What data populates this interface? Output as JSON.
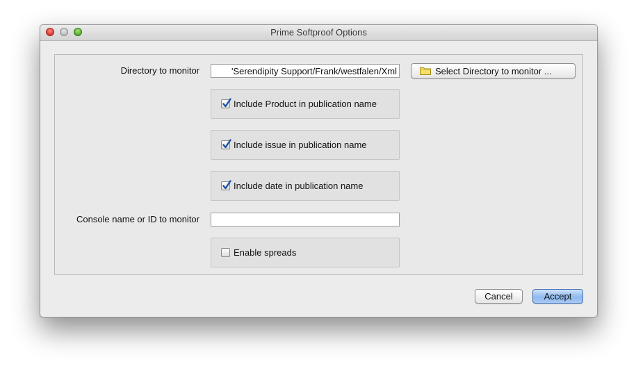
{
  "window": {
    "title": "Prime Softproof Options"
  },
  "directory": {
    "label": "Directory to monitor",
    "value": "'Serendipity Support/Frank/westfalen/Xml",
    "select_button": "Select Directory to monitor ..."
  },
  "options": [
    {
      "label": "Include Product in publication name",
      "checked": true
    },
    {
      "label": "Include issue in publication name",
      "checked": true
    },
    {
      "label": "Include date in publication name",
      "checked": true
    }
  ],
  "console": {
    "label": "Console name or ID to monitor",
    "value": ""
  },
  "spreads": {
    "label": "Enable spreads",
    "checked": false
  },
  "buttons": {
    "cancel": "Cancel",
    "accept": "Accept"
  },
  "icons": {
    "folder": "folder-icon",
    "checkmark": "checkmark-icon"
  },
  "colors": {
    "accent": "#8fb9ee",
    "checkmark": "#1d4fa8",
    "close": "#d8342b",
    "zoom": "#4fa52b"
  }
}
